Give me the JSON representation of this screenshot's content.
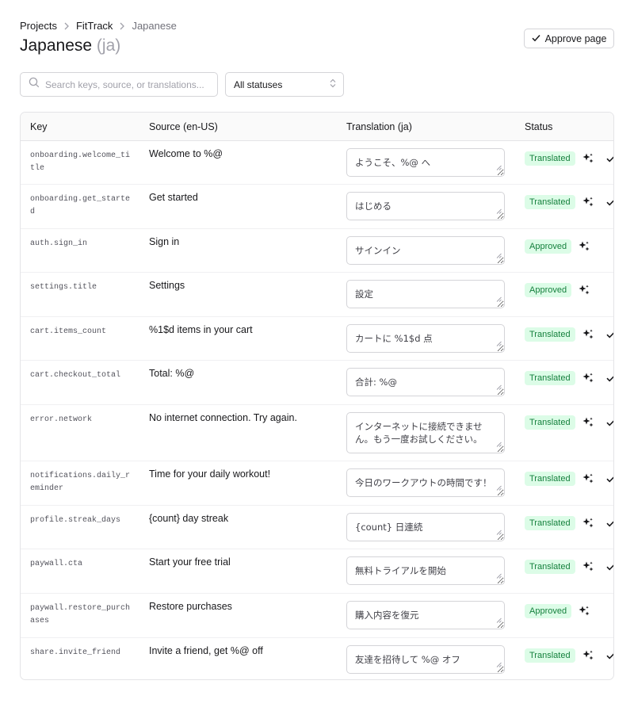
{
  "breadcrumb": {
    "projects": "Projects",
    "app": "FitTrack",
    "language": "Japanese"
  },
  "page": {
    "title": "Japanese",
    "lang_code": "(ja)"
  },
  "actions": {
    "approve_page": "Approve page"
  },
  "search": {
    "placeholder": "Search keys, source, or translations...",
    "value": ""
  },
  "filter": {
    "selected": "All statuses"
  },
  "table": {
    "headers": {
      "key": "Key",
      "source": "Source (en-US)",
      "translation": "Translation (ja)",
      "status": "Status"
    },
    "rows": [
      {
        "key": "onboarding.welcome_title",
        "source": "Welcome to %@",
        "translation": "ようこそ、%@ へ",
        "status": "Translated"
      },
      {
        "key": "onboarding.get_started",
        "source": "Get started",
        "translation": "はじめる",
        "status": "Translated"
      },
      {
        "key": "auth.sign_in",
        "source": "Sign in",
        "translation": "サインイン",
        "status": "Approved"
      },
      {
        "key": "settings.title",
        "source": "Settings",
        "translation": "設定",
        "status": "Approved"
      },
      {
        "key": "cart.items_count",
        "source": "%1$d items in your cart",
        "translation": "カートに %1$d 点",
        "status": "Translated"
      },
      {
        "key": "cart.checkout_total",
        "source": "Total: %@",
        "translation": "合計: %@",
        "status": "Translated"
      },
      {
        "key": "error.network",
        "source": "No internet connection. Try again.",
        "translation": "インターネットに接続できません。もう一度お試しください。",
        "status": "Translated"
      },
      {
        "key": "notifications.daily_reminder",
        "source": "Time for your daily workout!",
        "translation": "今日のワークアウトの時間です！",
        "status": "Translated"
      },
      {
        "key": "profile.streak_days",
        "source": "{count} day streak",
        "translation": "{count} 日連続",
        "status": "Translated"
      },
      {
        "key": "paywall.cta",
        "source": "Start your free trial",
        "translation": "無料トライアルを開始",
        "status": "Translated"
      },
      {
        "key": "paywall.restore_purchases",
        "source": "Restore purchases",
        "translation": "購入内容を復元",
        "status": "Approved"
      },
      {
        "key": "share.invite_friend",
        "source": "Invite a friend, get %@ off",
        "translation": "友達を招待して %@ オフ",
        "status": "Translated"
      }
    ]
  },
  "icons": {
    "ai_suggest": "sparkles-icon",
    "approve_row": "check-icon",
    "search": "search-icon",
    "select": "chevrons-updown-icon",
    "crumb_sep": "chevron-right-icon"
  },
  "colors": {
    "badge_bg": "#dcfce7",
    "badge_text": "#15803d",
    "border": "#e4e4e7",
    "muted": "#71717a"
  }
}
